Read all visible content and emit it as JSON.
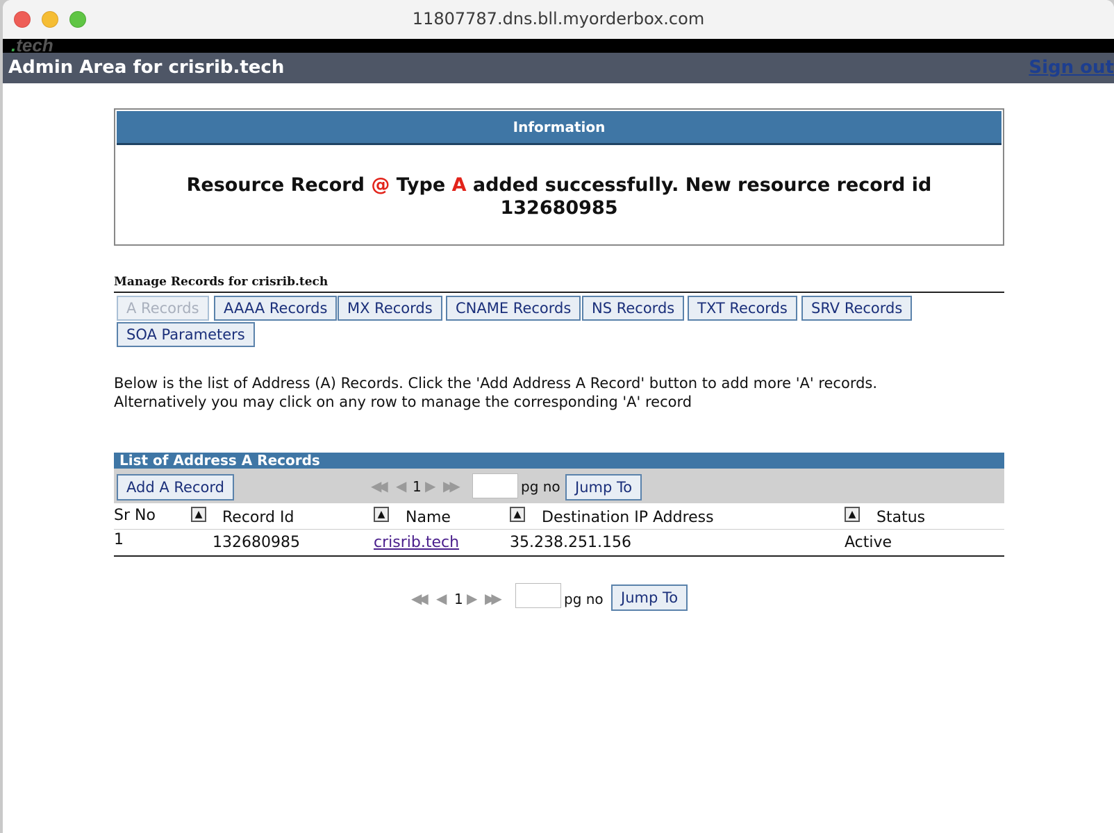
{
  "window": {
    "title": "11807787.dns.bll.myorderbox.com"
  },
  "brand": {
    "logo_dot": ".",
    "logo_text": "tech"
  },
  "header": {
    "title": "Admin Area for crisrib.tech",
    "signout": "Sign out"
  },
  "info": {
    "heading": "Information",
    "msg_part1": "Resource Record ",
    "msg_at": "@",
    "msg_part2": " Type ",
    "msg_type": "A",
    "msg_part3": " added successfully. New resource record id",
    "msg_id": "132680985"
  },
  "manage": {
    "title": "Manage Records for crisrib.tech",
    "tabs": [
      "A Records",
      "AAAA Records",
      "MX Records",
      "CNAME Records",
      "NS Records",
      "TXT Records",
      "SRV Records",
      "SOA Parameters"
    ]
  },
  "description": {
    "line1": "Below is the list of Address (A) Records. Click the 'Add Address A Record' button to add more 'A' records.",
    "line2": "Alternatively you may click on any row to manage the corresponding 'A' record"
  },
  "list": {
    "heading": "List of Address A Records",
    "add_button": "Add A Record",
    "page_number": "1",
    "pg_no_label": "pg no",
    "jump_button": "Jump To",
    "columns": {
      "sr_no": "Sr No",
      "record_id": "Record Id",
      "name": "Name",
      "destination": "Destination IP Address",
      "status": "Status"
    },
    "rows": [
      {
        "sr_no": "1",
        "record_id": "132680985",
        "name": "crisrib.tech",
        "destination": "35.238.251.156",
        "status": "Active"
      }
    ]
  },
  "icons": {
    "first_page": "double-left-arrow-icon",
    "prev_page": "left-arrow-icon",
    "next_page": "right-arrow-icon",
    "last_page": "double-right-arrow-icon",
    "sort": "sort-up-icon"
  },
  "colors": {
    "header_bg": "#4e5666",
    "section_blue": "#3f76a5",
    "highlight_red": "#e2231a",
    "link_blue": "#1d3e8f"
  }
}
